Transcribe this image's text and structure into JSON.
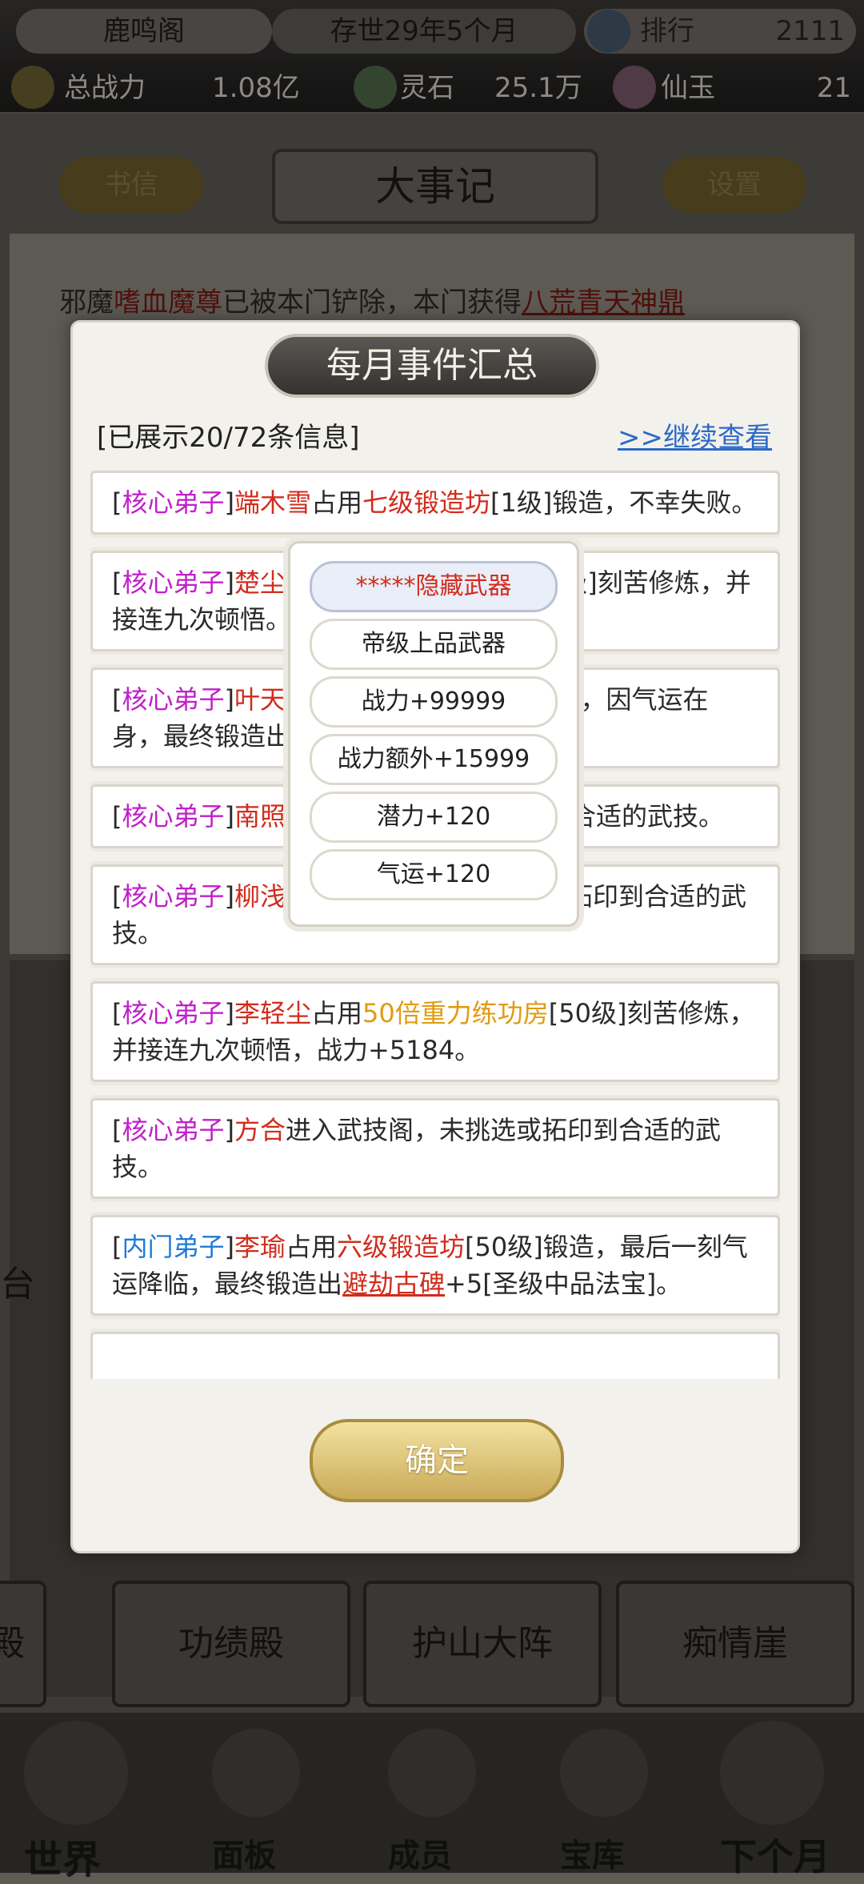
{
  "status_bar": {
    "sect_name": "鹿鸣阁",
    "age": "存世29年5个月",
    "rank_label": "排行",
    "rank_value": "2111",
    "power_label": "总战力",
    "power_value": "1.08亿",
    "spirit_stone_label": "灵石",
    "spirit_stone_value": "25.1万",
    "immortal_jade_label": "仙玉",
    "immortal_jade_value": "21"
  },
  "header": {
    "letters_label": "书信",
    "title": "大事记",
    "settings_label": "设置"
  },
  "background": {
    "first_line": {
      "pre": "邪魔",
      "name": "嗜血魔尊",
      "mid": "已被本门铲除，本门获得",
      "treasure": "八荒青天神鼎"
    },
    "left_edge_label": "台",
    "halls": [
      "殿",
      "功绩殿",
      "护山大阵",
      "痴情崖"
    ]
  },
  "bottom_nav": [
    "世界",
    "面板",
    "成员",
    "宝库",
    "下个月"
  ],
  "modal": {
    "title": "每月事件汇总",
    "count_text": "[已展示20/72条信息]",
    "more_link": ">>继续查看",
    "confirm_label": "确定",
    "events": [
      {
        "role": "核心弟子",
        "role_type": "core",
        "name": "端木雪",
        "verb": "占用",
        "building": "七级锻造坊",
        "building_color": "red",
        "tail": "[1级]锻造，不幸失败。"
      },
      {
        "role": "核心弟子",
        "role_type": "core",
        "name": "楚尘",
        "verb": "",
        "building": "",
        "building_color": "red",
        "tail": "房[50级]刻苦修炼，并接连九次顿悟。"
      },
      {
        "role": "核心弟子",
        "role_type": "core",
        "name": "叶天",
        "verb": "",
        "building": "",
        "building_color": "red",
        "tail": "级]锻造，因气运在身，最终锻造出[帝级上品武器]。"
      },
      {
        "role": "核心弟子",
        "role_type": "core",
        "name": "南照",
        "verb": "",
        "building": "",
        "building_color": "red",
        "tail": "拓印到合适的武技。"
      },
      {
        "role": "核心弟子",
        "role_type": "core",
        "name": "柳浅浅",
        "verb": "",
        "building": "",
        "building_color": "red",
        "tail": "进入武技阁，未挑选或拓印到合适的武技。"
      },
      {
        "role": "核心弟子",
        "role_type": "core",
        "name": "李轻尘",
        "verb": "占用",
        "building": "50倍重力练功房",
        "building_color": "orange",
        "tail": "[50级]刻苦修炼，并接连九次顿悟，战力+5184。"
      },
      {
        "role": "核心弟子",
        "role_type": "core",
        "name": "方合",
        "verb": "",
        "building": "",
        "building_color": "red",
        "tail": "进入武技阁，未挑选或拓印到合适的武技。"
      },
      {
        "role": "内门弟子",
        "role_type": "inner",
        "name": "李瑜",
        "verb": "占用",
        "building": "六级锻造坊",
        "building_color": "red",
        "tail": "[50级]锻造，最后一刻气运降临，最终锻造出",
        "treasure": "避劫古碑",
        "tail2": "+5[圣级中品法宝]。"
      }
    ]
  },
  "popup": {
    "header": "*****隐藏武器",
    "rows": [
      "帝级上品武器",
      "战力+99999",
      "战力额外+15999",
      "潜力+120",
      "气运+120"
    ]
  }
}
